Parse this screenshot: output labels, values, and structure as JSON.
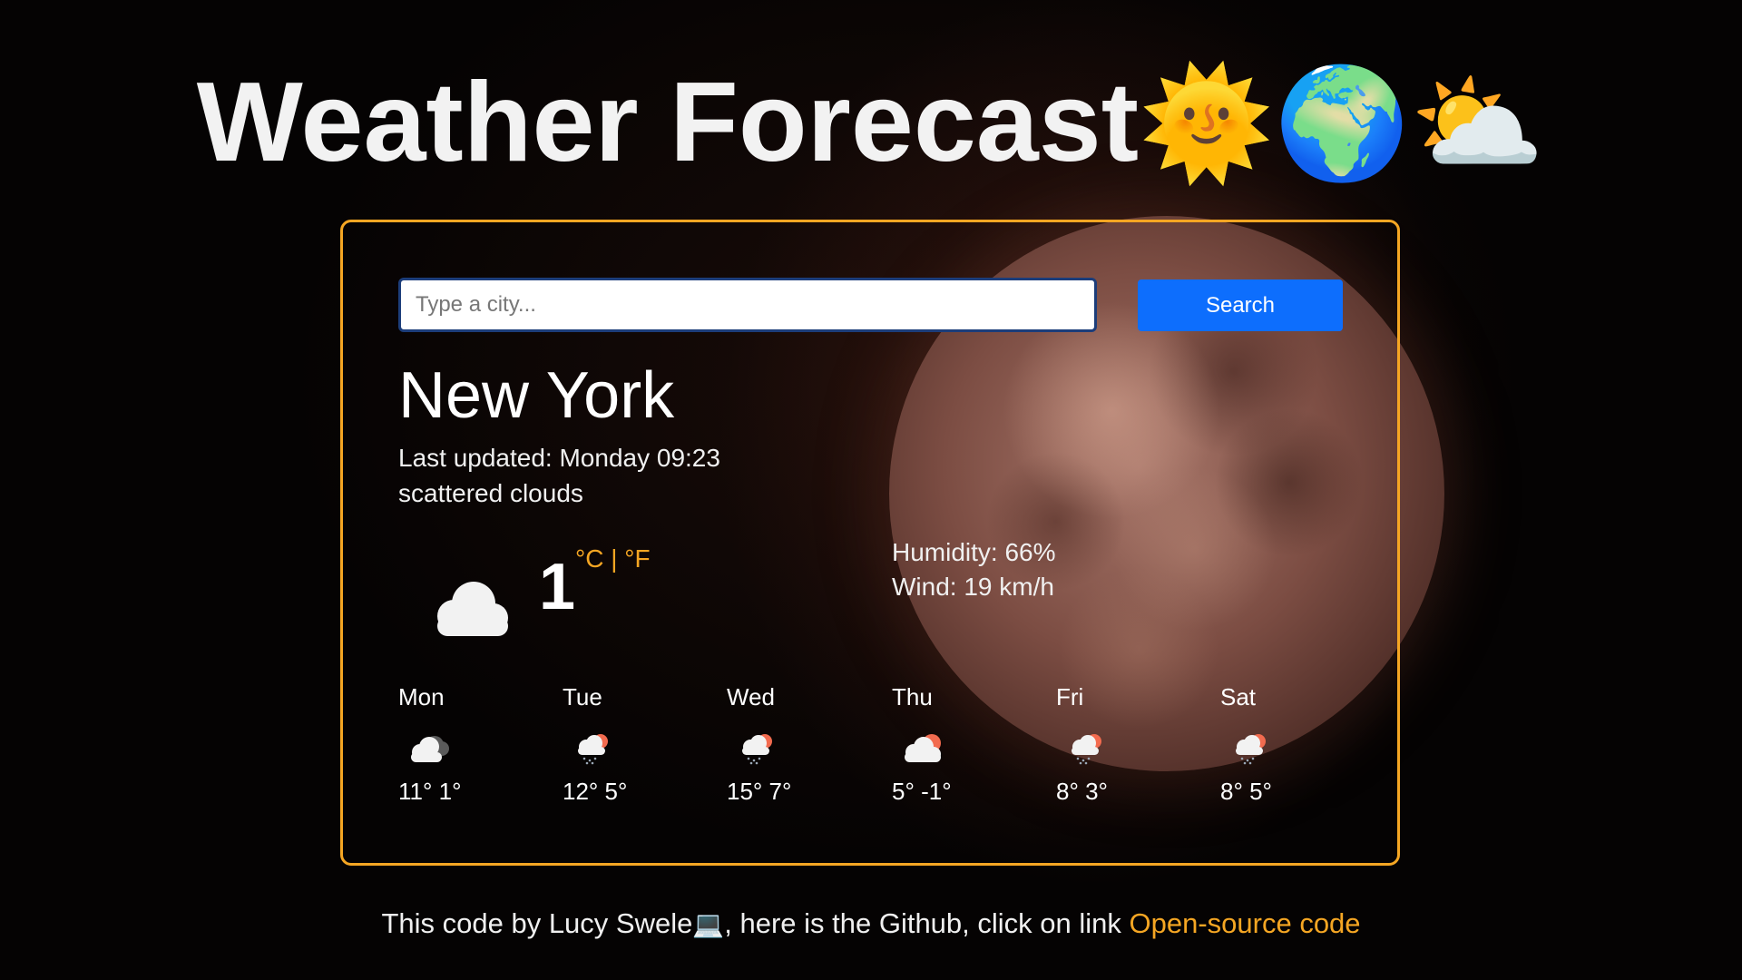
{
  "header": {
    "title": "Weather Forecast",
    "title_emojis": "🌞🌍⛅"
  },
  "search": {
    "placeholder": "Type a city...",
    "value": "",
    "button_label": "Search"
  },
  "current": {
    "city": "New York",
    "last_updated": "Last updated: Monday 09:23",
    "description": "scattered clouds",
    "temperature": "1",
    "unit_celsius": "°C",
    "unit_separator": " | ",
    "unit_fahrenheit": "°F",
    "humidity": "Humidity: 66%",
    "wind": "Wind: 19 km/h",
    "icon": "cloud-icon"
  },
  "forecast": [
    {
      "day": "Mon",
      "icon": "cloudy-dark-icon",
      "temps": "11° 1°"
    },
    {
      "day": "Tue",
      "icon": "rain-sun-icon",
      "temps": "12° 5°"
    },
    {
      "day": "Wed",
      "icon": "rain-sun-icon",
      "temps": "15° 7°"
    },
    {
      "day": "Thu",
      "icon": "cloud-sun-icon",
      "temps": "5° -1°"
    },
    {
      "day": "Fri",
      "icon": "rain-sun-icon",
      "temps": "8° 3°"
    },
    {
      "day": "Sat",
      "icon": "rain-sun-icon",
      "temps": "8° 5°"
    }
  ],
  "footer": {
    "text_before": "This code by Lucy Swele",
    "laptop_emoji": "💻",
    "text_after": ", here is the Github, click on link ",
    "link_label": "Open-source code"
  },
  "colors": {
    "accent": "#f5a623",
    "button": "#0d6efd",
    "background": "#000000"
  }
}
